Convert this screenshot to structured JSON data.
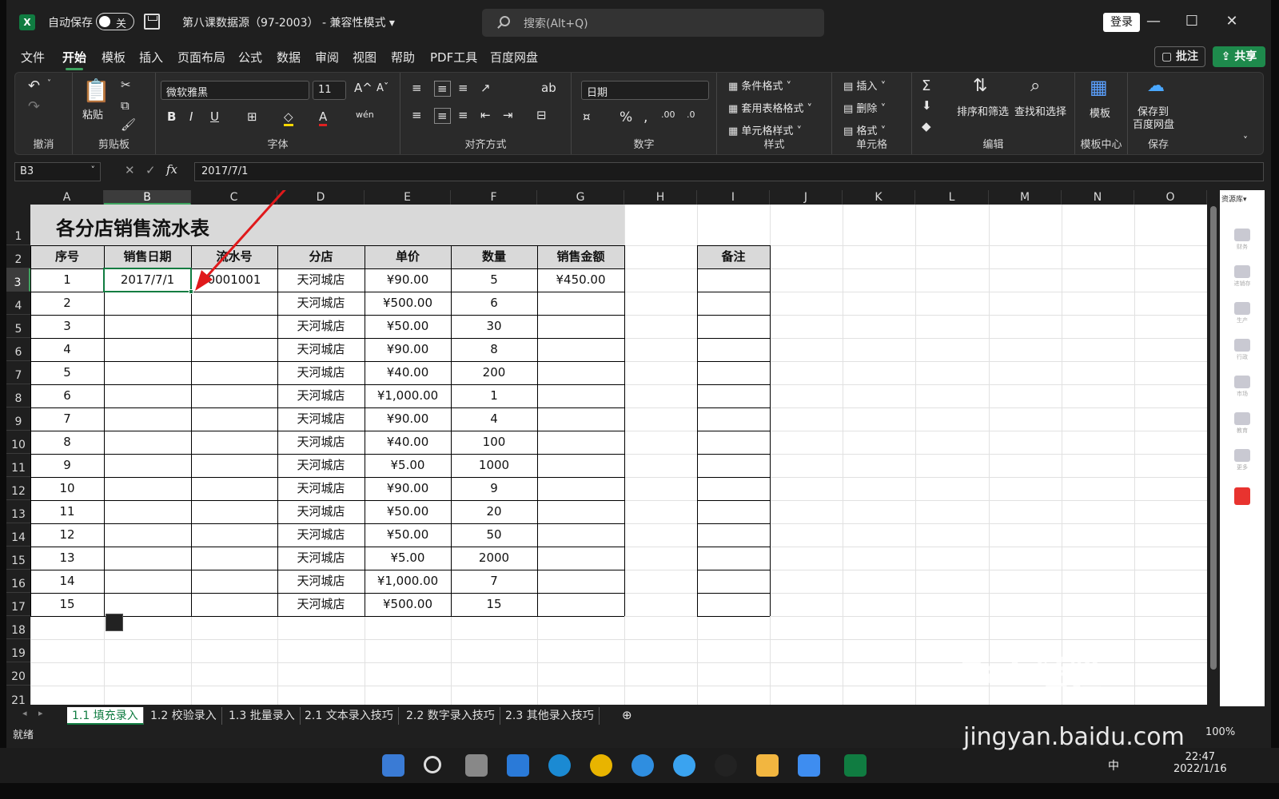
{
  "titlebar": {
    "autosave_label": "自动保存",
    "autosave_state": "关",
    "doc_title": "第八课数据源（97-2003） - 兼容性模式 ▾",
    "search_placeholder": "搜索(Alt+Q)",
    "login": "登录"
  },
  "menu": [
    "文件",
    "开始",
    "模板",
    "插入",
    "页面布局",
    "公式",
    "数据",
    "审阅",
    "视图",
    "帮助",
    "PDF工具",
    "百度网盘"
  ],
  "menu_active": "开始",
  "comment_btn": "批注",
  "share_btn": "共享",
  "ribbon": {
    "groups": {
      "undo": "撤消",
      "clipboard": "剪贴板",
      "font": "字体",
      "align": "对齐方式",
      "number": "数字",
      "styles": "样式",
      "cells": "单元格",
      "edit": "编辑",
      "template_center": "模板中心",
      "save": "保存"
    },
    "paste": "粘贴",
    "font_name": "微软雅黑",
    "font_size": "11",
    "number_format": "日期",
    "cond_format": "条件格式 ˅",
    "table_format": "套用表格格式 ˅",
    "cell_style": "单元格样式 ˅",
    "insert": "插入",
    "delete": "删除",
    "format": "格式",
    "sort_filter": "排序和筛选",
    "find_select": "查找和选择",
    "template": "模板",
    "save_to": "保存到",
    "baidu_disk": "百度网盘"
  },
  "formula_bar": {
    "name_box": "B3",
    "formula": "2017/7/1"
  },
  "columns": [
    "A",
    "B",
    "C",
    "D",
    "E",
    "F",
    "G",
    "H",
    "I",
    "J",
    "K",
    "L",
    "M",
    "N",
    "O"
  ],
  "rows": [
    "1",
    "2",
    "3",
    "4",
    "5",
    "6",
    "7",
    "8",
    "9",
    "10",
    "11",
    "12",
    "13",
    "14",
    "15",
    "16",
    "17",
    "18",
    "19",
    "20",
    "21"
  ],
  "sheet": {
    "title": "各分店销售流水表",
    "headers": [
      "序号",
      "销售日期",
      "流水号",
      "分店",
      "单价",
      "数量",
      "销售金额"
    ],
    "remark_header": "备注",
    "data": [
      [
        "1",
        "2017/7/1",
        "0001001",
        "天河城店",
        "¥90.00",
        "5",
        "¥450.00"
      ],
      [
        "2",
        "",
        "",
        "天河城店",
        "¥500.00",
        "6",
        ""
      ],
      [
        "3",
        "",
        "",
        "天河城店",
        "¥50.00",
        "30",
        ""
      ],
      [
        "4",
        "",
        "",
        "天河城店",
        "¥90.00",
        "8",
        ""
      ],
      [
        "5",
        "",
        "",
        "天河城店",
        "¥40.00",
        "200",
        ""
      ],
      [
        "6",
        "",
        "",
        "天河城店",
        "¥1,000.00",
        "1",
        ""
      ],
      [
        "7",
        "",
        "",
        "天河城店",
        "¥90.00",
        "4",
        ""
      ],
      [
        "8",
        "",
        "",
        "天河城店",
        "¥40.00",
        "100",
        ""
      ],
      [
        "9",
        "",
        "",
        "天河城店",
        "¥5.00",
        "1000",
        ""
      ],
      [
        "10",
        "",
        "",
        "天河城店",
        "¥90.00",
        "9",
        ""
      ],
      [
        "11",
        "",
        "",
        "天河城店",
        "¥50.00",
        "20",
        ""
      ],
      [
        "12",
        "",
        "",
        "天河城店",
        "¥50.00",
        "50",
        ""
      ],
      [
        "13",
        "",
        "",
        "天河城店",
        "¥5.00",
        "2000",
        ""
      ],
      [
        "14",
        "",
        "",
        "天河城店",
        "¥1,000.00",
        "7",
        ""
      ],
      [
        "15",
        "",
        "",
        "天河城店",
        "¥500.00",
        "15",
        ""
      ]
    ]
  },
  "side_panel": {
    "title": "资源库▾",
    "items": [
      "财务",
      "进销存",
      "生产",
      "行政",
      "市场",
      "教育",
      "更多"
    ]
  },
  "sheet_tabs": [
    "1.1 填充录入",
    "1.2 校验录入",
    "1.3 批量录入",
    "2.1 文本录入技巧",
    "2.2 数字录入技巧",
    "2.3 其他录入技巧"
  ],
  "active_tab": "1.1 填充录入",
  "status": {
    "ready": "就绪",
    "zoom": "100%"
  },
  "taskbar": {
    "time": "22:47",
    "date": "2022/1/16",
    "ime": "中"
  },
  "watermark": {
    "logo": "Bai 经验",
    "url": "jingyan.baidu.com"
  },
  "colors": {
    "accent": "#107c41",
    "arrow": "#e0191b",
    "header_fill": "#d9d9d9"
  }
}
